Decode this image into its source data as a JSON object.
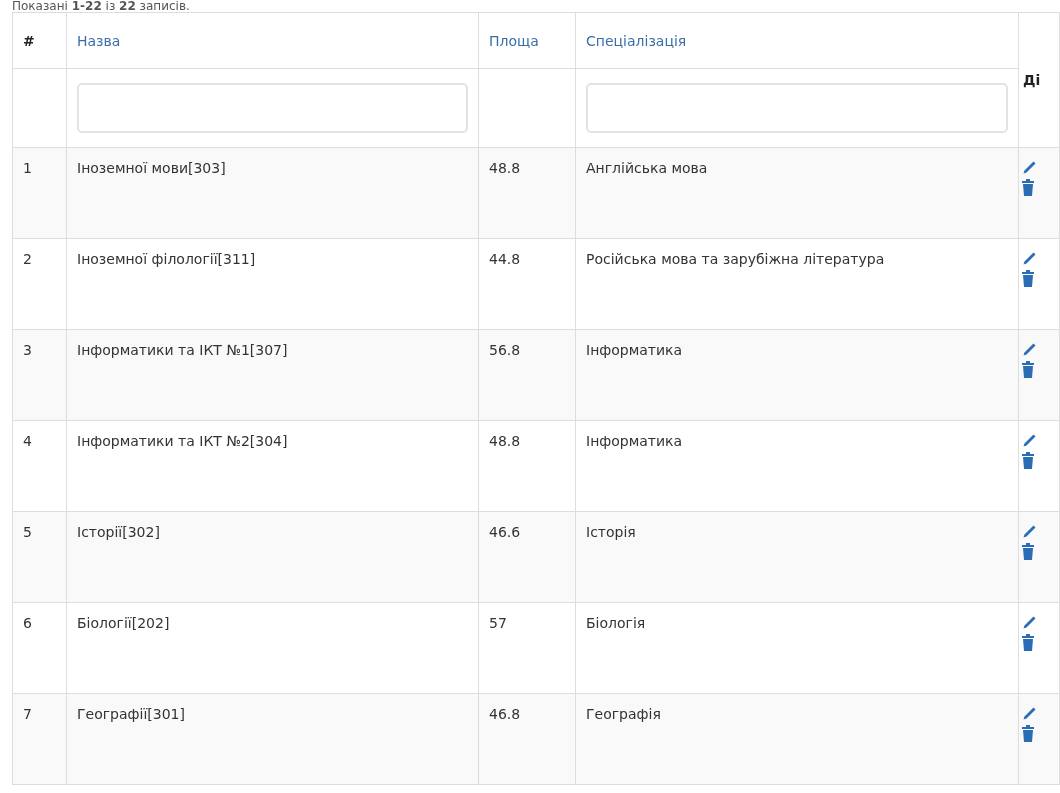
{
  "summary": "Показані **1-22** із **22** записів.",
  "table": {
    "columns": [
      {
        "label": "#",
        "kind": "plain"
      },
      {
        "label": "Назва",
        "kind": "sort",
        "filter": true
      },
      {
        "label": "Площа",
        "kind": "sort"
      },
      {
        "label": "Спеціалізація",
        "kind": "sort",
        "filter": true
      },
      {
        "label": "Ді",
        "kind": "actions"
      }
    ],
    "rows": [
      {
        "num": "1",
        "name": "Іноземної мови[303]",
        "area": "48.8",
        "spec": "Англійська мова"
      },
      {
        "num": "2",
        "name": "Іноземної філології[311]",
        "area": "44.8",
        "spec": "Російська мова та зарубіжна література"
      },
      {
        "num": "3",
        "name": "Інформатики та ІКТ №1[307]",
        "area": "56.8",
        "spec": "Інформатика"
      },
      {
        "num": "4",
        "name": "Інформатики та ІКТ №2[304]",
        "area": "48.8",
        "spec": "Інформатика"
      },
      {
        "num": "5",
        "name": "Історії[302]",
        "area": "46.6",
        "spec": "Історія"
      },
      {
        "num": "6",
        "name": "Біології[202]",
        "area": "57",
        "spec": "Біологія"
      },
      {
        "num": "7",
        "name": "Географії[301]",
        "area": "46.8",
        "spec": "Географія"
      }
    ]
  }
}
